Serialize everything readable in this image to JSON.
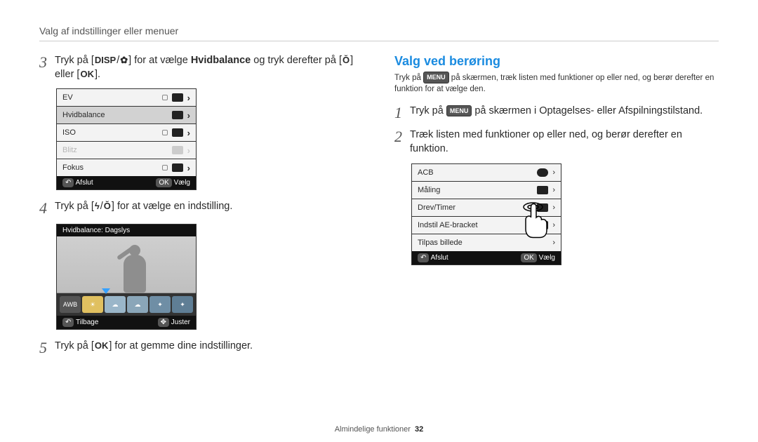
{
  "breadcrumb": "Valg af indstillinger eller menuer",
  "left": {
    "step3": {
      "num": "3",
      "t1": "Tryk på [",
      "disp": "DISP",
      "slash1": "/",
      "macro": "✿",
      "t2": "] for at vælge ",
      "bold": "Hvidbalance",
      "t3": " og tryk derefter på [",
      "timer": "Ŏ",
      "t4": "] eller [",
      "ok": "OK",
      "t5": "]."
    },
    "menu1": {
      "r1": "EV",
      "r2": "Hvidbalance",
      "r3": "ISO",
      "r4": "Blitz",
      "r5": "Fokus",
      "back_icon": "↶",
      "back": "Afslut",
      "ok": "OK",
      "sel": "Vælg"
    },
    "step4": {
      "num": "4",
      "t1": "Tryk på [",
      "flash": "ϟ",
      "slash": "/",
      "timer": "Ŏ",
      "t2": "] for at vælge en indstilling."
    },
    "wb": {
      "header": "Hvidbalance: Dagslys",
      "thumbs": [
        "AWB",
        "☀",
        "☁",
        "☁",
        "✦",
        "✦"
      ],
      "back_icon": "↶",
      "back": "Tilbage",
      "adj_icon": "✥",
      "adj": "Juster"
    },
    "step5": {
      "num": "5",
      "t1": "Tryk på [",
      "ok": "OK",
      "t2": "] for at gemme dine indstillinger."
    }
  },
  "right": {
    "title": "Valg ved berøring",
    "sub_a": "Tryk på ",
    "menu": "MENU",
    "sub_b": " på skærmen, træk listen med funktioner op eller ned, og berør derefter en funktion for at vælge den.",
    "step1": {
      "num": "1",
      "t1": "Tryk på ",
      "menu": "MENU",
      "t2": " på skærmen i Optagelses- eller Afspilningstilstand."
    },
    "step2": {
      "num": "2",
      "t1": "Træk listen med funktioner op eller ned, og berør derefter en funktion."
    },
    "menu2": {
      "r1": "ACB",
      "r2": "Måling",
      "r3": "Drev/Timer",
      "r4": "Indstil AE-bracket",
      "r5": "Tilpas billede",
      "back_icon": "↶",
      "back": "Afslut",
      "ok": "OK",
      "sel": "Vælg"
    }
  },
  "footer": {
    "section": "Almindelige funktioner",
    "page": "32"
  }
}
